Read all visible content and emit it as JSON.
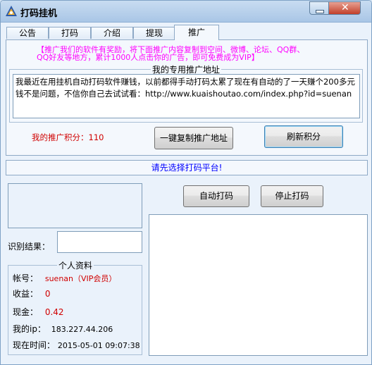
{
  "window": {
    "title": "打码挂机"
  },
  "tabs": [
    {
      "label": "公告",
      "active": false
    },
    {
      "label": "打码",
      "active": false
    },
    {
      "label": "介绍",
      "active": false
    },
    {
      "label": "提现",
      "active": false
    },
    {
      "label": "推广",
      "active": true
    }
  ],
  "promo": {
    "line1": "【推广我们的软件有奖励，将下面推广内容复制到空间、微博、论坛、QQ群、",
    "line2": "QQ好友等地方，累计1000人点击你的广告，即可免费成为VIP】",
    "group_label": "我的专用推广地址",
    "text": "我最近在用挂机自动打码软件赚钱，以前都得手动打码太累了现在有自动的了一天赚个200多元钱不是问题，不信你自己去试试看：http://www.kuaishoutao.com/index.php?id=suenan",
    "points_label": "我的推广积分：110",
    "copy_button": "一键复制推广地址",
    "refresh_button": "刷新积分"
  },
  "status": {
    "message": "请先选择打码平台!"
  },
  "controls": {
    "auto_button": "自动打码",
    "stop_button": "停止打码"
  },
  "recognition": {
    "label": "识别结果：",
    "value": ""
  },
  "profile": {
    "title": "个人资料",
    "account_label": "帐号：",
    "account_value": "suenan（VIP会员）",
    "income_label": "收益：",
    "income_value": "0",
    "cash_label": "现金：",
    "cash_value": "0.42",
    "ip_label": "我的ip：",
    "ip_value": "183.227.44.206",
    "time_label": "现在时间：",
    "time_value": "2015-05-01 09:07:38"
  },
  "colors": {
    "promo": "#ff00ff",
    "points": "#d00000",
    "status": "#0000ff"
  }
}
